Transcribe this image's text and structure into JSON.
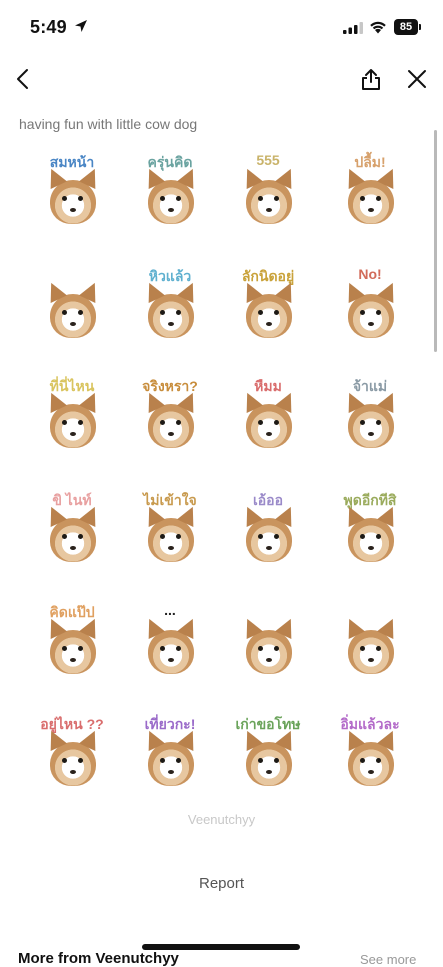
{
  "status_bar": {
    "time": "5:49",
    "battery": "85"
  },
  "nav": {
    "back_icon": "chevron-left-icon",
    "share_icon": "share-icon",
    "close_icon": "close-icon"
  },
  "subtitle": "having fun with little cow dog",
  "stickers": [
    {
      "caption": "สมหน้า",
      "color": "#4a86c5"
    },
    {
      "caption": "ครุ่นคิด",
      "color": "#6aa3a0"
    },
    {
      "caption": "555",
      "color": "#c9b36a"
    },
    {
      "caption": "ปลื้ม!",
      "color": "#d7a16c"
    },
    {
      "caption": "",
      "color": "#7a9bc0"
    },
    {
      "caption": "หิวแล้ว",
      "color": "#5fb0cf"
    },
    {
      "caption": "ลักนิดอยู่",
      "color": "#c9a23a"
    },
    {
      "caption": "No!",
      "color": "#d26b5a"
    },
    {
      "caption": "ที่นี่ไหน",
      "color": "#d9c45e"
    },
    {
      "caption": "จริงหรา?",
      "color": "#c88d3c"
    },
    {
      "caption": "หืมม",
      "color": "#d96d6d"
    },
    {
      "caption": "จ้าแม่",
      "color": "#8a9aa5"
    },
    {
      "caption": "ขิ ไนท์",
      "color": "#e8a0a0"
    },
    {
      "caption": "ไม่เข้าใจ",
      "color": "#c89a4e"
    },
    {
      "caption": "เอ้ออ",
      "color": "#9a8ac9"
    },
    {
      "caption": "พูดอีกทีสิ",
      "color": "#9aab5c"
    },
    {
      "caption": "คิดแป๊ป",
      "color": "#e0a060"
    },
    {
      "caption": "...",
      "color": "#222222"
    },
    {
      "caption": "",
      "color": "#888888"
    },
    {
      "caption": "",
      "color": "#e08aa0"
    },
    {
      "caption": "อยู่ไหน ??",
      "color": "#d96d6d"
    },
    {
      "caption": "เที่ยวกะ!",
      "color": "#9a6ac9"
    },
    {
      "caption": "เก่าขอโทษ",
      "color": "#6aa35a"
    },
    {
      "caption": "อิ่มแล้วละ",
      "color": "#b36ac9"
    }
  ],
  "author": "Veenutchyy",
  "report": "Report",
  "more_section": {
    "title": "More from Veenutchyy",
    "see_more": "See more"
  }
}
